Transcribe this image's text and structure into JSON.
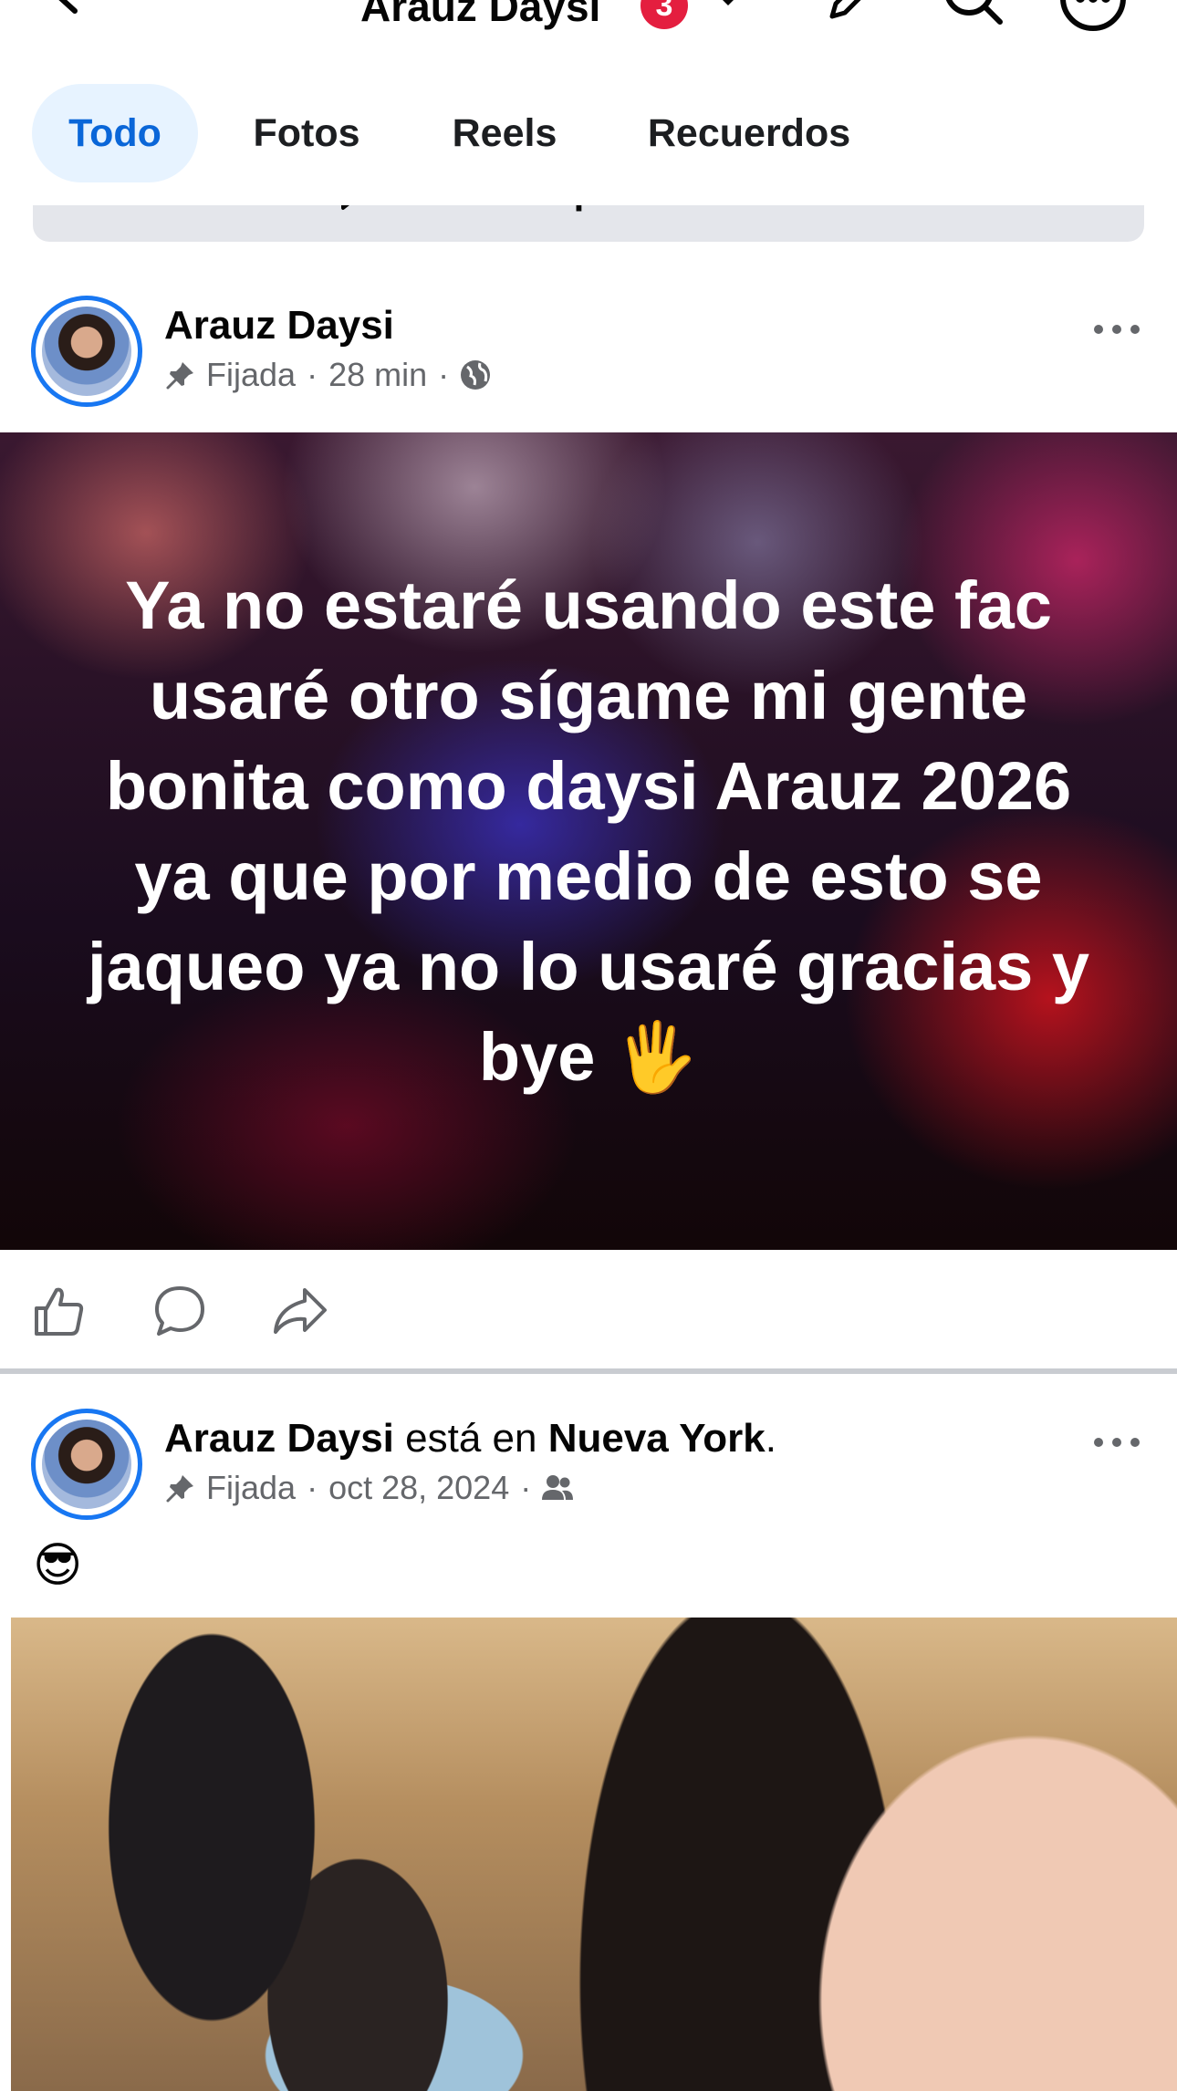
{
  "header": {
    "title": "Arauz Daysi",
    "notification_count": "3"
  },
  "tabs": [
    {
      "label": "Todo",
      "active": true
    },
    {
      "label": "Fotos",
      "active": false
    },
    {
      "label": "Reels",
      "active": false
    },
    {
      "label": "Recuerdos",
      "active": false
    }
  ],
  "manage": {
    "label": "Administrar publicaciones"
  },
  "posts": [
    {
      "author": "Arauz Daysi",
      "pinned_label": "Fijada",
      "time": "28 min",
      "separator": "·",
      "audience_icon": "globe-icon",
      "body": "Ya no estaré usando este fac usaré otro sígame mi gente bonita como daysi Arauz 2026 ya que por medio de esto se jaqueo ya no lo usaré gracias y bye 🖐"
    },
    {
      "author": "Arauz Daysi",
      "checkin_text": "está en",
      "location": "Nueva York",
      "period": ".",
      "pinned_label": "Fijada",
      "time": "oct 28, 2024",
      "separator": "·",
      "audience_icon": "friends-icon",
      "body": "😎"
    }
  ],
  "colors": {
    "accent": "#1877f2",
    "tab_active_bg": "#e7f3ff",
    "tab_active_text": "#0a66d8",
    "badge": "#e41e3f",
    "secondary_text": "#65676b"
  }
}
